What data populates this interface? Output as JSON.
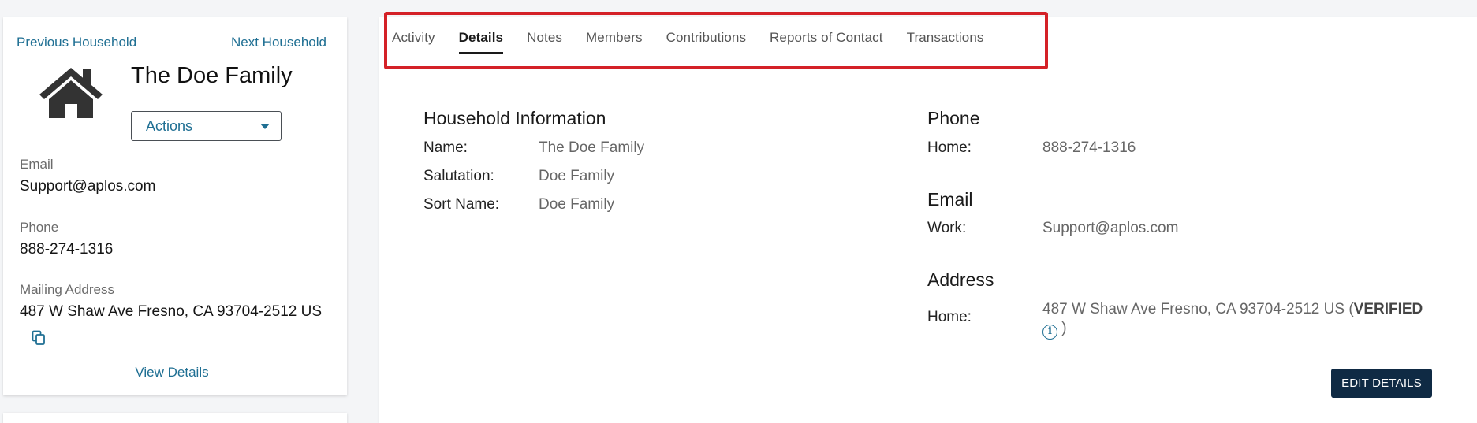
{
  "household": {
    "prev_label": "Previous Household",
    "next_label": "Next Household",
    "title": "The Doe Family",
    "actions_label": "Actions",
    "email_label": "Email",
    "email_value": "Support@aplos.com",
    "phone_label": "Phone",
    "phone_value": "888-274-1316",
    "address_label": "Mailing Address",
    "address_value": "487 W Shaw Ave Fresno, CA 93704-2512 US",
    "view_details_label": "View Details"
  },
  "tabs": [
    {
      "label": "Activity",
      "active": false
    },
    {
      "label": "Details",
      "active": true
    },
    {
      "label": "Notes",
      "active": false
    },
    {
      "label": "Members",
      "active": false
    },
    {
      "label": "Contributions",
      "active": false
    },
    {
      "label": "Reports of Contact",
      "active": false
    },
    {
      "label": "Transactions",
      "active": false
    }
  ],
  "details": {
    "household_info": {
      "title": "Household Information",
      "name_label": "Name:",
      "name_value": "The Doe Family",
      "salutation_label": "Salutation:",
      "salutation_value": "Doe Family",
      "sort_name_label": "Sort Name:",
      "sort_name_value": "Doe Family"
    },
    "phone": {
      "title": "Phone",
      "home_label": "Home:",
      "home_value": "888-274-1316"
    },
    "email": {
      "title": "Email",
      "work_label": "Work:",
      "work_value": "Support@aplos.com"
    },
    "address": {
      "title": "Address",
      "home_label": "Home:",
      "home_value": "487 W Shaw Ave Fresno, CA 93704-2512 US (",
      "verified_label": "VERIFIED",
      "info_glyph": "i",
      "close_paren": ")"
    },
    "edit_button_label": "EDIT DETAILS"
  },
  "colors": {
    "link": "#1f6f93",
    "highlight_border": "#d42127",
    "edit_button_bg": "#0f2a44"
  },
  "icons": {
    "house": "house-icon",
    "copy": "copy-icon",
    "caret": "chevron-down-icon",
    "info": "info-icon"
  }
}
